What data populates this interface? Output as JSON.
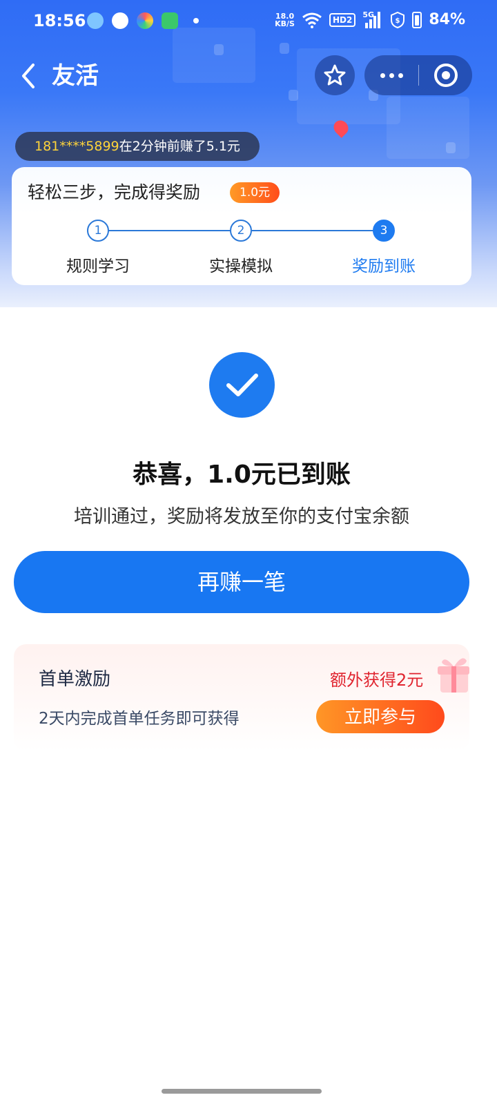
{
  "status_bar": {
    "time": "18:56",
    "net_speed_value": "18.0",
    "net_speed_unit": "KB/S",
    "hd_label": "HD2",
    "signal_label": "5G",
    "battery": "84%"
  },
  "nav": {
    "title": "友活"
  },
  "ticker": {
    "phone": "181****5899",
    "message": "在2分钟前赚了5.1元"
  },
  "steps": {
    "title": "轻松三步，完成得奖励",
    "badge": "1.0元",
    "items": [
      {
        "number": "1",
        "label": "规则学习"
      },
      {
        "number": "2",
        "label": "实操模拟"
      },
      {
        "number": "3",
        "label": "奖励到账"
      }
    ]
  },
  "result": {
    "title": "恭喜，1.0元已到账",
    "subtitle": "培训通过，奖励将发放至你的支付宝余额",
    "button_label": "再赚一笔"
  },
  "incentive": {
    "title": "首单激励",
    "extra": "额外获得2元",
    "description": "2天内完成首单任务即可获得",
    "button_label": "立即参与"
  },
  "colors": {
    "primary_blue": "#1877f2",
    "step_blue": "#2a78d8",
    "ticker_yellow": "#ffd43a",
    "reward_red": "#e0242f",
    "orange_start": "#ff9626",
    "orange_end": "#ff4a1c"
  }
}
